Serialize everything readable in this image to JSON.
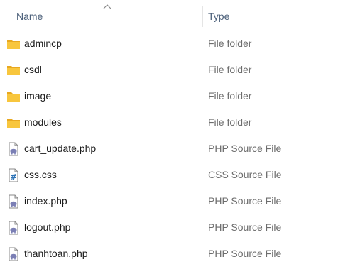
{
  "header": {
    "name_label": "Name",
    "type_label": "Type",
    "sort_indicator": "sort-ascending-arrow"
  },
  "colors": {
    "header_text": "#4c607a",
    "folder_yellow": "#f8c63d",
    "php_purple": "#7b7fb5",
    "css_blue": "#2f74b7",
    "type_text": "#6d6d6d"
  },
  "files": [
    {
      "name": "admincp",
      "type": "File folder",
      "icon": "folder-icon"
    },
    {
      "name": "csdl",
      "type": "File folder",
      "icon": "folder-icon"
    },
    {
      "name": "image",
      "type": "File folder",
      "icon": "folder-icon"
    },
    {
      "name": "modules",
      "type": "File folder",
      "icon": "folder-icon"
    },
    {
      "name": "cart_update.php",
      "type": "PHP Source File",
      "icon": "php-file-icon"
    },
    {
      "name": "css.css",
      "type": "CSS Source File",
      "icon": "css-file-icon"
    },
    {
      "name": "index.php",
      "type": "PHP Source File",
      "icon": "php-file-icon"
    },
    {
      "name": "logout.php",
      "type": "PHP Source File",
      "icon": "php-file-icon"
    },
    {
      "name": "thanhtoan.php",
      "type": "PHP Source File",
      "icon": "php-file-icon"
    }
  ]
}
